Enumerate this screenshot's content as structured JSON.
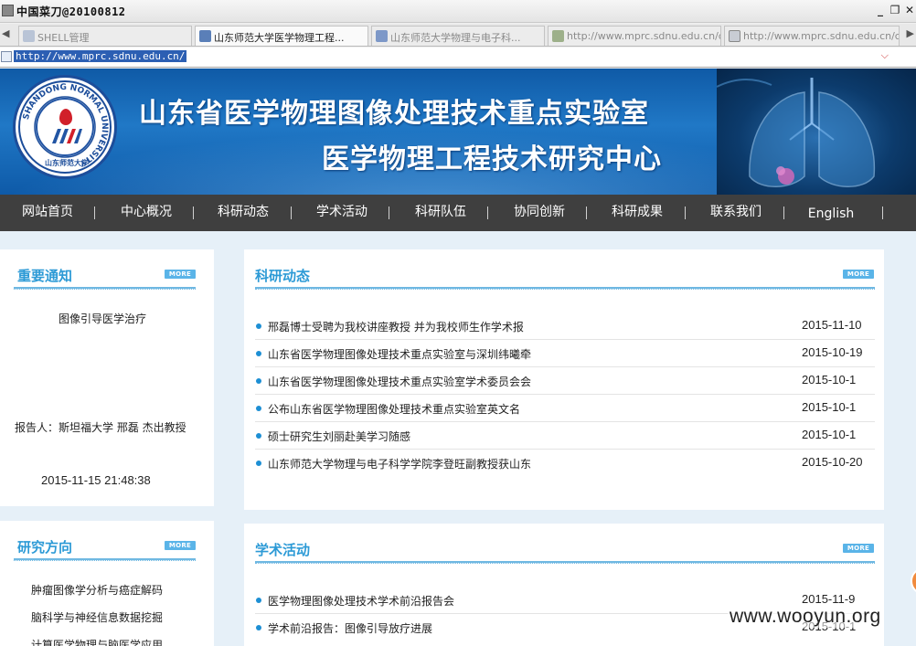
{
  "window": {
    "title": "中国菜刀@20100812",
    "min_glyph": "_",
    "restore_glyph": "❐",
    "close_glyph": "✕"
  },
  "tabs": [
    {
      "label": "SHELL管理",
      "active": false
    },
    {
      "label": "山东师范大学医学物理工程...",
      "active": true
    },
    {
      "label": "山东师范大学物理与电子科...",
      "active": false
    },
    {
      "label": "http://www.mprc.sdnu.edu.cn/c...",
      "active": false
    },
    {
      "label": "http://www.mprc.sdnu.edu.cn/c...",
      "active": false
    }
  ],
  "address": {
    "url": "http://www.mprc.sdnu.edu.cn/"
  },
  "banner": {
    "logo_ring_text": "SHANDONG NORMAL UNIVERSITY",
    "logo_cn": "山东师范大学",
    "title_line1": "山东省医学物理图像处理技术重点实验室",
    "title_line2": "医学物理工程技术研究中心"
  },
  "nav": {
    "items": [
      "网站首页",
      "中心概况",
      "科研动态",
      "学术活动",
      "科研队伍",
      "协同创新",
      "科研成果",
      "联系我们",
      "English"
    ],
    "separator": "|"
  },
  "notice": {
    "title": "重要通知",
    "more_label": "MORE",
    "headline": "图像引导医学治疗",
    "reporter": "报告人：斯坦福大学 邢磊 杰出教授",
    "timestamp": "2015-11-15 21:48:38"
  },
  "research": {
    "title": "研究方向",
    "more_label": "MORE",
    "items": [
      "肿瘤图像学分析与癌症解码",
      "脑科学与神经信息数据挖掘",
      "计算医学物理与脑医学应用"
    ]
  },
  "news": {
    "title": "科研动态",
    "more_label": "MORE",
    "items": [
      {
        "text": "邢磊博士受聘为我校讲座教授 并为我校师生作学术报",
        "date": "2015-11-10"
      },
      {
        "text": "山东省医学物理图像处理技术重点实验室与深圳纬曦牵",
        "date": "2015-10-19"
      },
      {
        "text": "山东省医学物理图像处理技术重点实验室学术委员会会",
        "date": "2015-10-1"
      },
      {
        "text": "公布山东省医学物理图像处理技术重点实验室英文名",
        "date": "2015-10-1"
      },
      {
        "text": "硕士研究生刘丽赴美学习随感",
        "date": "2015-10-1"
      },
      {
        "text": "山东师范大学物理与电子科学学院李登旺副教授获山东",
        "date": "2015-10-20"
      }
    ]
  },
  "activities": {
    "title": "学术活动",
    "more_label": "MORE",
    "items": [
      {
        "text": "医学物理图像处理技术学术前沿报告会",
        "date": "2015-11-9"
      },
      {
        "text": "学术前沿报告：图像引导放疗进展",
        "date": "2015-10-1"
      }
    ]
  },
  "watermark": "www.wooyun.org",
  "colors": {
    "accent": "#2c9ad6",
    "nav_bg": "#3f3f3f",
    "banner_blue": "#1567b6"
  }
}
